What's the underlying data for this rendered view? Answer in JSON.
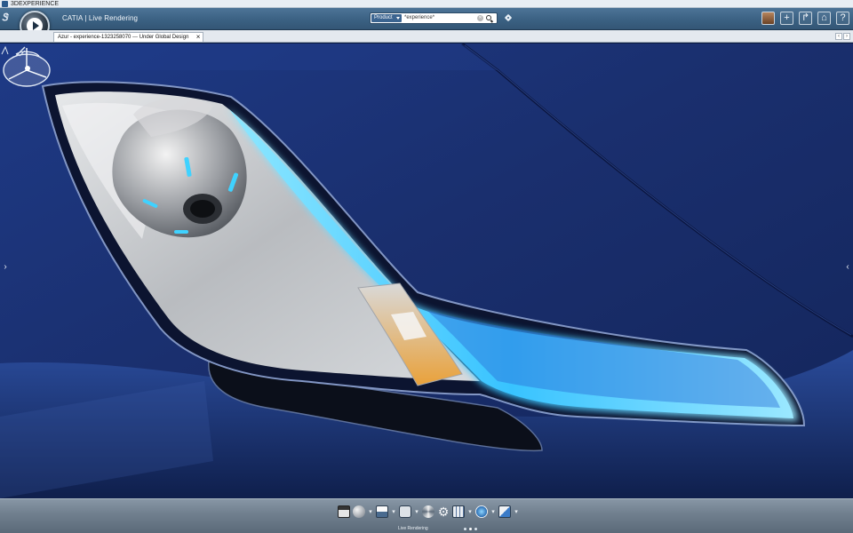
{
  "window": {
    "title": "3DEXPERIENCE"
  },
  "topbar": {
    "brand_glyph": "3DS",
    "app_title": "CATIA | Live Rendering",
    "search": {
      "scope": "Product",
      "query": "*experience*"
    },
    "icons": [
      "avatar-icon",
      "add-icon",
      "share-icon",
      "home-icon",
      "help-icon"
    ]
  },
  "tabs": [
    {
      "label": "Azur - experience-1323258070 --- Under Global Design"
    }
  ],
  "viewport": {
    "left_arrow": "›",
    "right_arrow": "‹"
  },
  "actionbar": {
    "section_label": "Live Rendering",
    "tools": [
      "clapboard-icon",
      "sphere-icon",
      "render-settings-icon",
      "camera-icon",
      "environment-icon",
      "gear-icon",
      "grid-icon",
      "magic-icon",
      "publish-icon"
    ],
    "page_dots": 3,
    "active_dot": 1
  },
  "colors": {
    "car_paint": "#1c3478",
    "led_glow": "#4fd0ff",
    "topbar": "#3b6183",
    "actionbar": "#6f7e8d"
  }
}
